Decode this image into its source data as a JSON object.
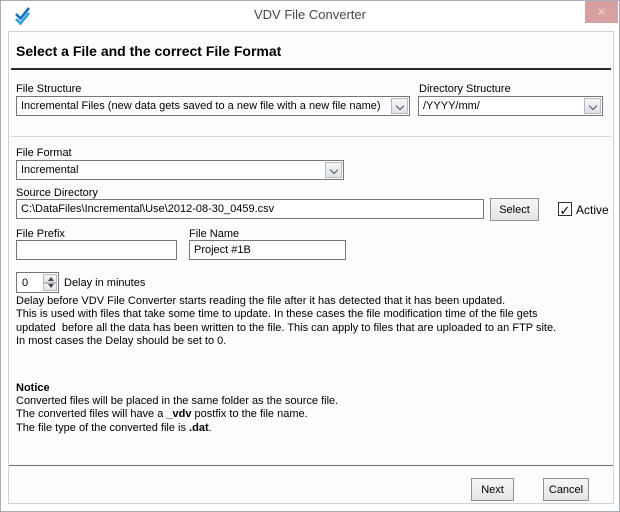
{
  "window": {
    "title": "VDV File Converter"
  },
  "icons": {
    "close": "✕",
    "checkmark": "✓",
    "app_logo": "double-checkmark-logo"
  },
  "header": {
    "title": "Select a File and the correct File Format"
  },
  "form": {
    "file_structure": {
      "label": "File Structure",
      "value": "Incremental Files (new data gets saved to a new file with a new file name)"
    },
    "directory_structure": {
      "label": "Directory Structure",
      "value": "/YYYY/mm/"
    },
    "file_format": {
      "label": "File Format",
      "value": "Incremental"
    },
    "source_directory": {
      "label": "Source Directory",
      "value": "C:\\DataFiles\\Incremental\\Use\\2012-08-30_0459.csv",
      "select_button": "Select"
    },
    "active_checkbox": {
      "label": "Active",
      "checked": true
    },
    "file_prefix": {
      "label": "File Prefix",
      "value": ""
    },
    "file_name": {
      "label": "File Name",
      "value": "Project #1B"
    },
    "delay": {
      "value": "0",
      "label": "Delay in minutes"
    }
  },
  "delay_description": {
    "lines": [
      "Delay before VDV File Converter starts reading the file after it has detected that it has been updated.",
      "This is used with files that take some time to update. In these cases the file modification time of the file gets",
      "updated  before all the data has been written to the file. This can apply to files that are uploaded to an FTP site.",
      "In most cases the Delay should be set to 0."
    ]
  },
  "notice": {
    "heading": "Notice",
    "line1": "Converted files will be placed in the same folder as the source file.",
    "line2": {
      "pre": "The converted files will have a ",
      "bold": "_vdv",
      "post": " postfix to the file name."
    },
    "line3": {
      "pre": "The file type of the converted file is ",
      "bold": ".dat",
      "post": "."
    }
  },
  "footer": {
    "next_label": "Next",
    "cancel_label": "Cancel"
  },
  "colors": {
    "close_button_bg": "#d9a0a1",
    "logo_blue_dark": "#1b74bb",
    "logo_blue_light": "#2aa3e0",
    "input_border": "#767676",
    "heading_rule": "#2a2a2a"
  }
}
